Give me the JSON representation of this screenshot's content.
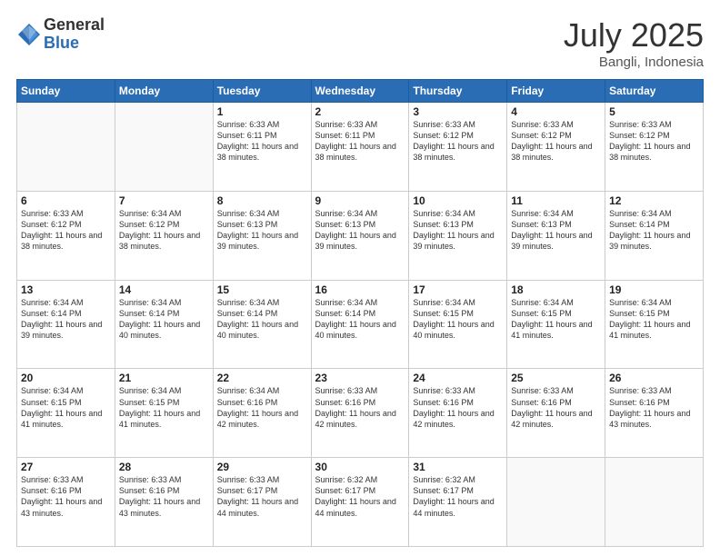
{
  "logo": {
    "general": "General",
    "blue": "Blue"
  },
  "title": {
    "month": "July 2025",
    "location": "Bangli, Indonesia"
  },
  "weekdays": [
    "Sunday",
    "Monday",
    "Tuesday",
    "Wednesday",
    "Thursday",
    "Friday",
    "Saturday"
  ],
  "weeks": [
    [
      {
        "day": "",
        "info": ""
      },
      {
        "day": "",
        "info": ""
      },
      {
        "day": "1",
        "info": "Sunrise: 6:33 AM\nSunset: 6:11 PM\nDaylight: 11 hours\nand 38 minutes."
      },
      {
        "day": "2",
        "info": "Sunrise: 6:33 AM\nSunset: 6:11 PM\nDaylight: 11 hours\nand 38 minutes."
      },
      {
        "day": "3",
        "info": "Sunrise: 6:33 AM\nSunset: 6:12 PM\nDaylight: 11 hours\nand 38 minutes."
      },
      {
        "day": "4",
        "info": "Sunrise: 6:33 AM\nSunset: 6:12 PM\nDaylight: 11 hours\nand 38 minutes."
      },
      {
        "day": "5",
        "info": "Sunrise: 6:33 AM\nSunset: 6:12 PM\nDaylight: 11 hours\nand 38 minutes."
      }
    ],
    [
      {
        "day": "6",
        "info": "Sunrise: 6:33 AM\nSunset: 6:12 PM\nDaylight: 11 hours\nand 38 minutes."
      },
      {
        "day": "7",
        "info": "Sunrise: 6:34 AM\nSunset: 6:12 PM\nDaylight: 11 hours\nand 38 minutes."
      },
      {
        "day": "8",
        "info": "Sunrise: 6:34 AM\nSunset: 6:13 PM\nDaylight: 11 hours\nand 39 minutes."
      },
      {
        "day": "9",
        "info": "Sunrise: 6:34 AM\nSunset: 6:13 PM\nDaylight: 11 hours\nand 39 minutes."
      },
      {
        "day": "10",
        "info": "Sunrise: 6:34 AM\nSunset: 6:13 PM\nDaylight: 11 hours\nand 39 minutes."
      },
      {
        "day": "11",
        "info": "Sunrise: 6:34 AM\nSunset: 6:13 PM\nDaylight: 11 hours\nand 39 minutes."
      },
      {
        "day": "12",
        "info": "Sunrise: 6:34 AM\nSunset: 6:14 PM\nDaylight: 11 hours\nand 39 minutes."
      }
    ],
    [
      {
        "day": "13",
        "info": "Sunrise: 6:34 AM\nSunset: 6:14 PM\nDaylight: 11 hours\nand 39 minutes."
      },
      {
        "day": "14",
        "info": "Sunrise: 6:34 AM\nSunset: 6:14 PM\nDaylight: 11 hours\nand 40 minutes."
      },
      {
        "day": "15",
        "info": "Sunrise: 6:34 AM\nSunset: 6:14 PM\nDaylight: 11 hours\nand 40 minutes."
      },
      {
        "day": "16",
        "info": "Sunrise: 6:34 AM\nSunset: 6:14 PM\nDaylight: 11 hours\nand 40 minutes."
      },
      {
        "day": "17",
        "info": "Sunrise: 6:34 AM\nSunset: 6:15 PM\nDaylight: 11 hours\nand 40 minutes."
      },
      {
        "day": "18",
        "info": "Sunrise: 6:34 AM\nSunset: 6:15 PM\nDaylight: 11 hours\nand 41 minutes."
      },
      {
        "day": "19",
        "info": "Sunrise: 6:34 AM\nSunset: 6:15 PM\nDaylight: 11 hours\nand 41 minutes."
      }
    ],
    [
      {
        "day": "20",
        "info": "Sunrise: 6:34 AM\nSunset: 6:15 PM\nDaylight: 11 hours\nand 41 minutes."
      },
      {
        "day": "21",
        "info": "Sunrise: 6:34 AM\nSunset: 6:15 PM\nDaylight: 11 hours\nand 41 minutes."
      },
      {
        "day": "22",
        "info": "Sunrise: 6:34 AM\nSunset: 6:16 PM\nDaylight: 11 hours\nand 42 minutes."
      },
      {
        "day": "23",
        "info": "Sunrise: 6:33 AM\nSunset: 6:16 PM\nDaylight: 11 hours\nand 42 minutes."
      },
      {
        "day": "24",
        "info": "Sunrise: 6:33 AM\nSunset: 6:16 PM\nDaylight: 11 hours\nand 42 minutes."
      },
      {
        "day": "25",
        "info": "Sunrise: 6:33 AM\nSunset: 6:16 PM\nDaylight: 11 hours\nand 42 minutes."
      },
      {
        "day": "26",
        "info": "Sunrise: 6:33 AM\nSunset: 6:16 PM\nDaylight: 11 hours\nand 43 minutes."
      }
    ],
    [
      {
        "day": "27",
        "info": "Sunrise: 6:33 AM\nSunset: 6:16 PM\nDaylight: 11 hours\nand 43 minutes."
      },
      {
        "day": "28",
        "info": "Sunrise: 6:33 AM\nSunset: 6:16 PM\nDaylight: 11 hours\nand 43 minutes."
      },
      {
        "day": "29",
        "info": "Sunrise: 6:33 AM\nSunset: 6:17 PM\nDaylight: 11 hours\nand 44 minutes."
      },
      {
        "day": "30",
        "info": "Sunrise: 6:32 AM\nSunset: 6:17 PM\nDaylight: 11 hours\nand 44 minutes."
      },
      {
        "day": "31",
        "info": "Sunrise: 6:32 AM\nSunset: 6:17 PM\nDaylight: 11 hours\nand 44 minutes."
      },
      {
        "day": "",
        "info": ""
      },
      {
        "day": "",
        "info": ""
      }
    ]
  ]
}
